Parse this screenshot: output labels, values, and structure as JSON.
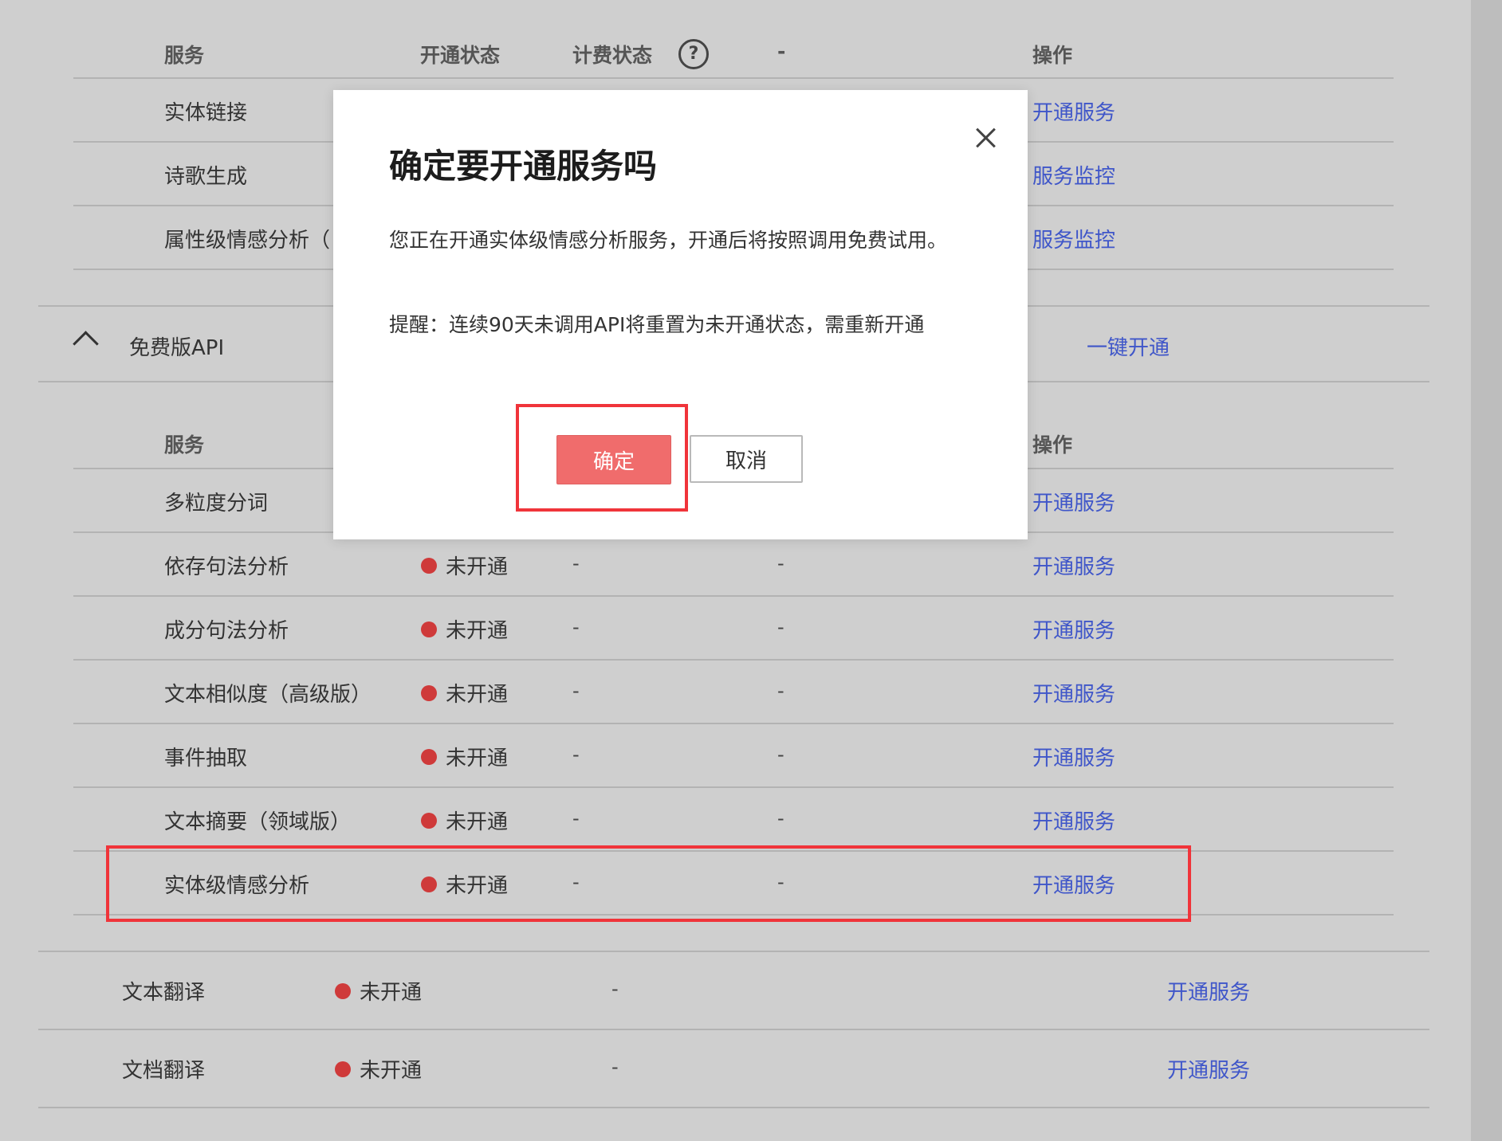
{
  "top_table": {
    "headers": {
      "service": "服务",
      "status": "开通状态",
      "billing": "计费状态",
      "dash": "-",
      "action": "操作"
    },
    "rows": [
      {
        "name": "实体链接",
        "action": "开通服务"
      },
      {
        "name": "诗歌生成",
        "action": "服务监控"
      },
      {
        "name": "属性级情感分析（",
        "action": "服务监控"
      }
    ]
  },
  "free_api_section": {
    "title": "免费版API",
    "one_click": "一键开通",
    "headers": {
      "service": "服务",
      "action": "操作"
    },
    "rows": [
      {
        "name": "多粒度分词",
        "status": "",
        "billing": "",
        "col4": "",
        "action": "开通服务"
      },
      {
        "name": "依存句法分析",
        "status": "未开通",
        "billing": "-",
        "col4": "-",
        "action": "开通服务"
      },
      {
        "name": "成分句法分析",
        "status": "未开通",
        "billing": "-",
        "col4": "-",
        "action": "开通服务"
      },
      {
        "name": "文本相似度（高级版）",
        "status": "未开通",
        "billing": "-",
        "col4": "-",
        "action": "开通服务"
      },
      {
        "name": "事件抽取",
        "status": "未开通",
        "billing": "-",
        "col4": "-",
        "action": "开通服务"
      },
      {
        "name": "文本摘要（领域版）",
        "status": "未开通",
        "billing": "-",
        "col4": "-",
        "action": "开通服务"
      },
      {
        "name": "实体级情感分析",
        "status": "未开通",
        "billing": "-",
        "col4": "-",
        "action": "开通服务"
      }
    ]
  },
  "bottom_rows": [
    {
      "name": "文本翻译",
      "status": "未开通",
      "billing": "-",
      "action": "开通服务"
    },
    {
      "name": "文档翻译",
      "status": "未开通",
      "billing": "-",
      "action": "开通服务"
    }
  ],
  "modal": {
    "title": "确定要开通服务吗",
    "text": " 您正在开通实体级情感分析服务，开通后将按照调用免费试用。",
    "reminder": " 提醒：连续90天未调用API将重置为未开通状态，需重新开通",
    "confirm": "确定",
    "cancel": "取消"
  },
  "colors": {
    "link": "#3f56c9",
    "status_dot": "#cf3a3a",
    "confirm_button": "#f06c6c",
    "highlight": "#f0343a"
  }
}
